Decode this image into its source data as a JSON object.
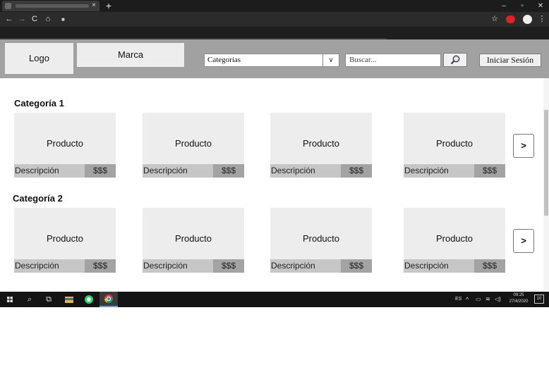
{
  "browser": {
    "tab_close": "×",
    "new_tab": "+",
    "window_controls": {
      "minimize": "–",
      "maximize": "▫",
      "close": "✕"
    },
    "nav_icons": [
      "back-arrow-icon",
      "forward-arrow-icon",
      "reload-icon",
      "home-icon",
      "lock-icon"
    ],
    "toolbar_icons": [
      "star-icon",
      "extension-icon",
      "profile-icon",
      "menu-icon"
    ]
  },
  "header": {
    "logo": "Logo",
    "brand": "Marca",
    "category_select": "Categorías",
    "search_placeholder": "Buscar...",
    "search_icon": "magnifier-icon",
    "login": "Iniciar Sesión"
  },
  "sections": [
    {
      "title": "Categoría 1",
      "products": [
        {
          "name": "Producto",
          "description": "Descripción",
          "price": "$$$"
        },
        {
          "name": "Producto",
          "description": "Descripción",
          "price": "$$$"
        },
        {
          "name": "Producto",
          "description": "Descripción",
          "price": "$$$"
        },
        {
          "name": "Producto",
          "description": "Descripción",
          "price": "$$$"
        }
      ],
      "next": ">"
    },
    {
      "title": "Categoría 2",
      "products": [
        {
          "name": "Producto",
          "description": "Descripción",
          "price": "$$$"
        },
        {
          "name": "Producto",
          "description": "Descripción",
          "price": "$$$"
        },
        {
          "name": "Producto",
          "description": "Descripción",
          "price": "$$$"
        },
        {
          "name": "Producto",
          "description": "Descripción",
          "price": "$$$"
        }
      ],
      "next": ">"
    }
  ],
  "taskbar": {
    "language": "ES",
    "time": "09:25",
    "date": "27/4/2020",
    "notifications_count": "10",
    "accent": "#6a9bd6"
  }
}
